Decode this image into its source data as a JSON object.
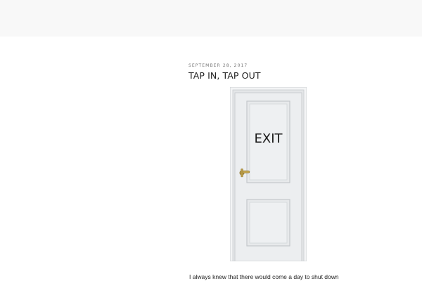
{
  "post": {
    "date": "SEPTEMBER 28, 2017",
    "title": "TAP IN, TAP OUT",
    "featured_image": {
      "sign_text": "EXIT",
      "door_color": "#e9eaec",
      "handle_color": "#b89a46"
    },
    "excerpt": "I always knew that there would come a day to shut down"
  }
}
